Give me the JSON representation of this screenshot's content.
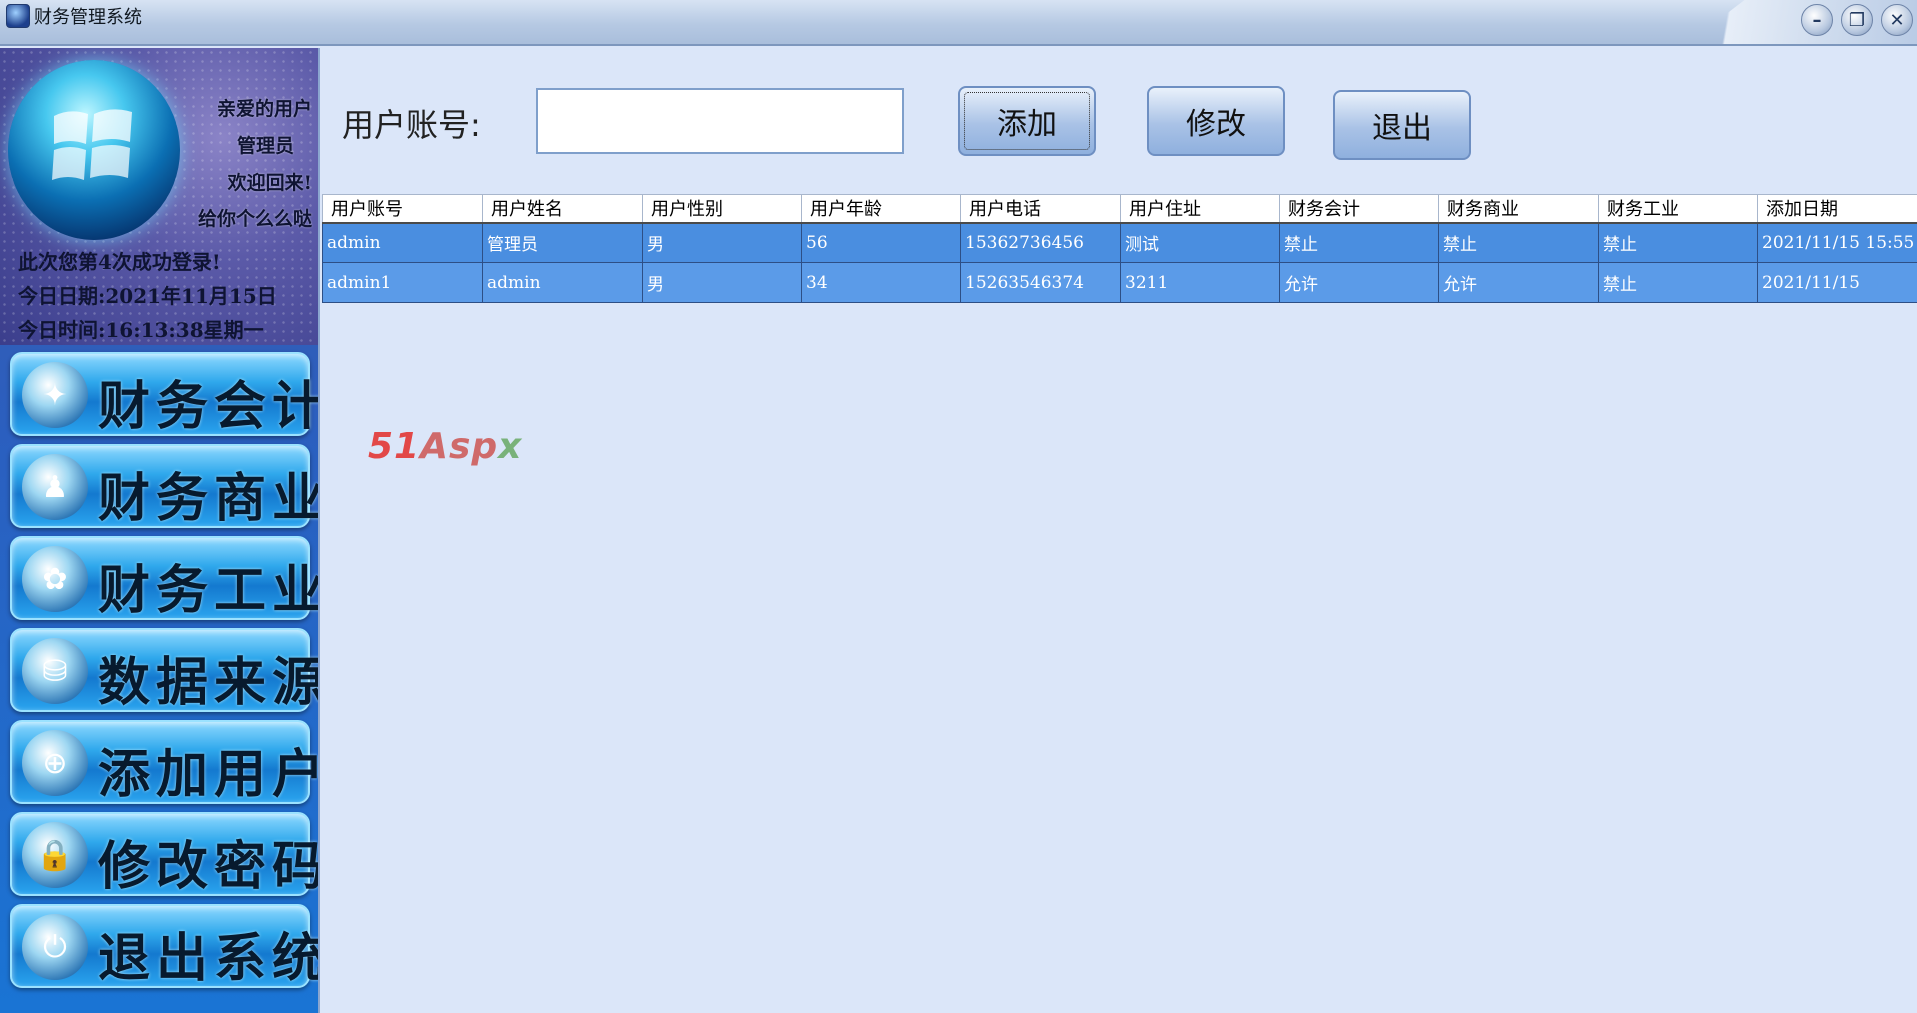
{
  "window": {
    "title": "财务管理系统",
    "controls": {
      "minimize": "–",
      "restore": "❐",
      "close": "✕"
    }
  },
  "sidebar": {
    "welcome": {
      "lines": [
        "亲爱的用户",
        "管理员",
        "欢迎回来!",
        "给你个么么哒"
      ],
      "login_count_text": "此次您第4次成功登录!",
      "date_text": "今日日期:2021年11月15日",
      "time_text": "今日时间:16:13:38星期一"
    },
    "nav": [
      {
        "label": "财务会计",
        "icon": "accounting-icon"
      },
      {
        "label": "财务商业",
        "icon": "commerce-icon"
      },
      {
        "label": "财务工业",
        "icon": "industry-icon"
      },
      {
        "label": "数据来源",
        "icon": "data-source-icon"
      },
      {
        "label": "添加用户",
        "icon": "add-user-icon"
      },
      {
        "label": "修改密码",
        "icon": "lock-icon"
      },
      {
        "label": "退出系统",
        "icon": "power-icon"
      }
    ]
  },
  "form": {
    "account_label": "用户账号:",
    "account_value": "",
    "buttons": {
      "add": "添加",
      "edit": "修改",
      "exit": "退出"
    }
  },
  "table": {
    "columns": [
      "用户账号",
      "用户姓名",
      "用户性别",
      "用户年龄",
      "用户电话",
      "用户住址",
      "财务会计",
      "财务商业",
      "财务工业",
      "添加日期"
    ],
    "rows": [
      [
        "admin",
        "管理员",
        "男",
        "56",
        "15362736456",
        "测试",
        "禁止",
        "禁止",
        "禁止",
        "2021/11/15 15:55"
      ],
      [
        "admin1",
        "admin",
        "男",
        "34",
        "15263546374",
        "3211",
        "允许",
        "允许",
        "禁止",
        "2021/11/15"
      ]
    ]
  },
  "watermark": {
    "part1": "51",
    "part2": "Asp",
    "part3": "x"
  }
}
